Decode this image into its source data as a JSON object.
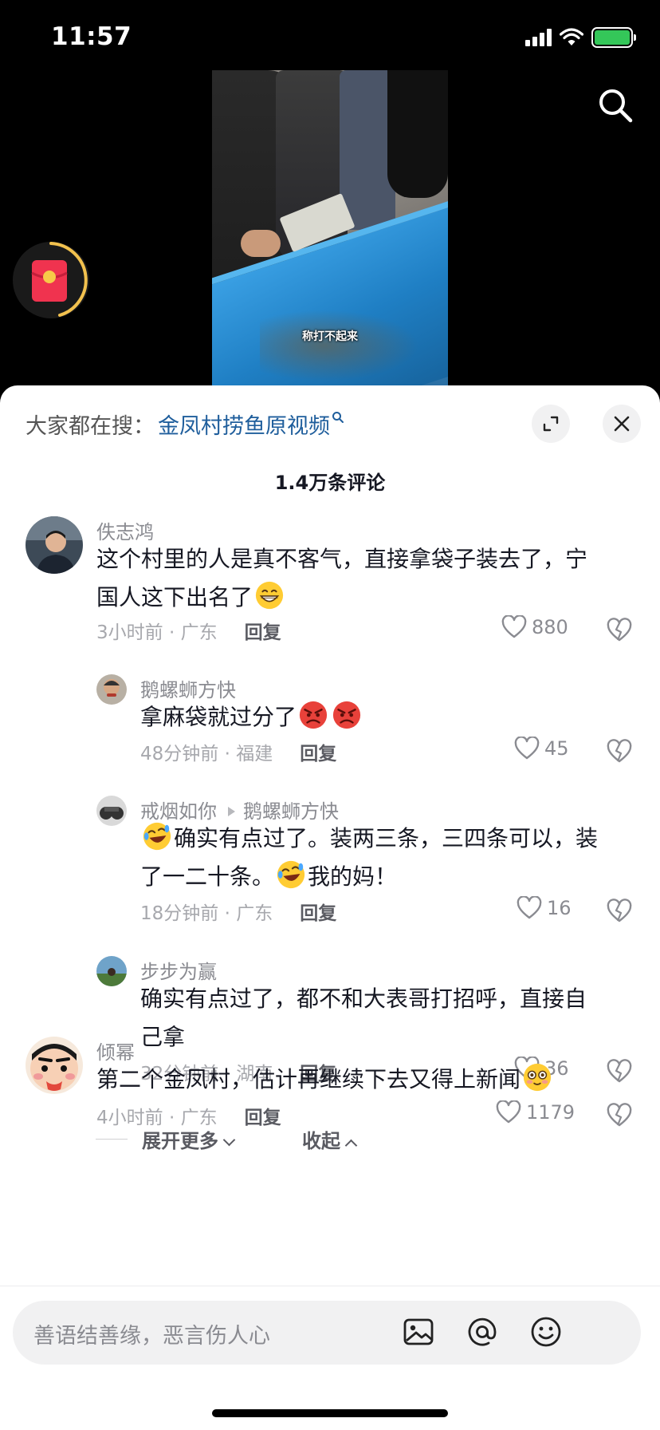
{
  "status_bar": {
    "time": "11:57"
  },
  "video": {
    "caption": "称打不起来"
  },
  "sheet": {
    "hot_search_prefix": "大家都在搜：",
    "hot_search_term": "金凤村捞鱼原视频",
    "comment_count": "1.4万条评论"
  },
  "comments": [
    {
      "name": "佚志鸿",
      "text_line1": "这个村里的人是真不客气，直接拿袋子装去了，宁",
      "text_line2": "国人这下出名了",
      "emoji": "grin-emoji",
      "meta": "3小时前 · 广东",
      "reply_label": "回复",
      "likes": "880"
    },
    {
      "name": "鹅螺蛳方快",
      "text": "拿麻袋就过分了",
      "emoji": "angry-emoji",
      "meta": "48分钟前 · 福建",
      "reply_label": "回复",
      "likes": "45"
    },
    {
      "name": "戒烟如你",
      "reply_to": "鹅螺蛳方快",
      "text_line1": "确实有点过了。装两三条，三四条可以，装",
      "text_line2_a": "了一二十条。",
      "text_line2_b": "我的妈！",
      "emoji": "laugh-cry-emoji",
      "meta": "18分钟前 · 广东",
      "reply_label": "回复",
      "likes": "16"
    },
    {
      "name": "步步为赢",
      "text_line1": "确实有点过了，都不和大表哥打招呼，直接自",
      "text_line2": "己拿",
      "meta": "32分钟前 · 湖南",
      "reply_label": "回复",
      "likes": "36"
    },
    {
      "name": "倾幂",
      "text": "第二个金凤村，估计再继续下去又得上新闻",
      "emoji": "blush-emoji",
      "meta": "4小时前 · 广东",
      "reply_label": "回复",
      "likes": "1179"
    }
  ],
  "thread_controls": {
    "expand_more": "展开更多",
    "collapse": "收起"
  },
  "input": {
    "placeholder": "善语结善缘，恶言伤人心"
  },
  "colors": {
    "link_blue": "#1f5e9c",
    "text_primary": "#161823",
    "text_secondary": "#8a8b91",
    "battery_green": "#34c759"
  }
}
